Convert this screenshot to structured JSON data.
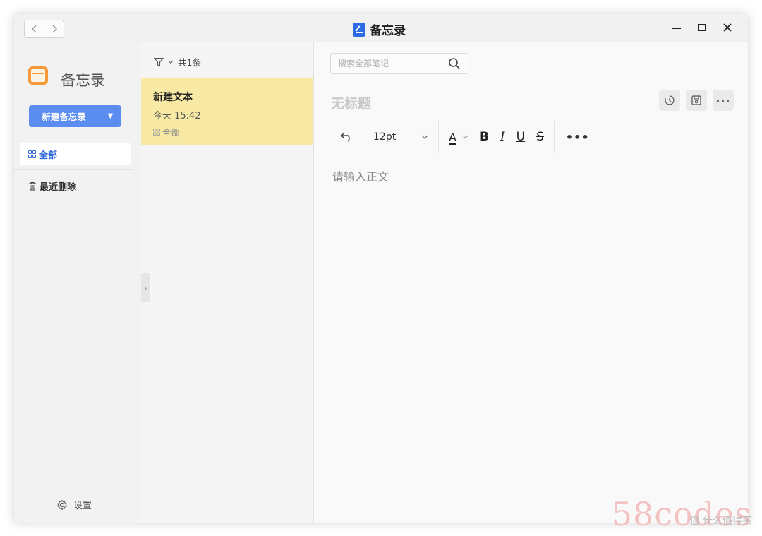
{
  "window": {
    "title": "备忘录"
  },
  "sidebar": {
    "app_name": "备忘录",
    "new_note_label": "新建备忘录",
    "categories": [
      {
        "label": "全部",
        "icon": "grid-icon",
        "active": true
      },
      {
        "label": "最近删除",
        "icon": "trash-icon",
        "active": false
      }
    ],
    "settings_label": "设置"
  },
  "notelist": {
    "count_label": "共1条",
    "notes": [
      {
        "title": "新建文本",
        "time": "今天 15:42",
        "category": "全部"
      }
    ]
  },
  "editor": {
    "search_placeholder": "搜索全部笔记",
    "title_placeholder": "无标题",
    "font_size": "12pt",
    "format_buttons": {
      "color": "A",
      "bold": "B",
      "italic": "I",
      "underline": "U",
      "strike": "S"
    },
    "more_label": "•••",
    "body_placeholder": "请输入正文"
  },
  "watermark": {
    "text": "58codes",
    "sub": "值 什么值得买"
  },
  "colors": {
    "accent": "#5b8cf0",
    "selected_note": "#f8eaa4",
    "logo": "#f59a3b",
    "active_category": "#2b63d9"
  }
}
